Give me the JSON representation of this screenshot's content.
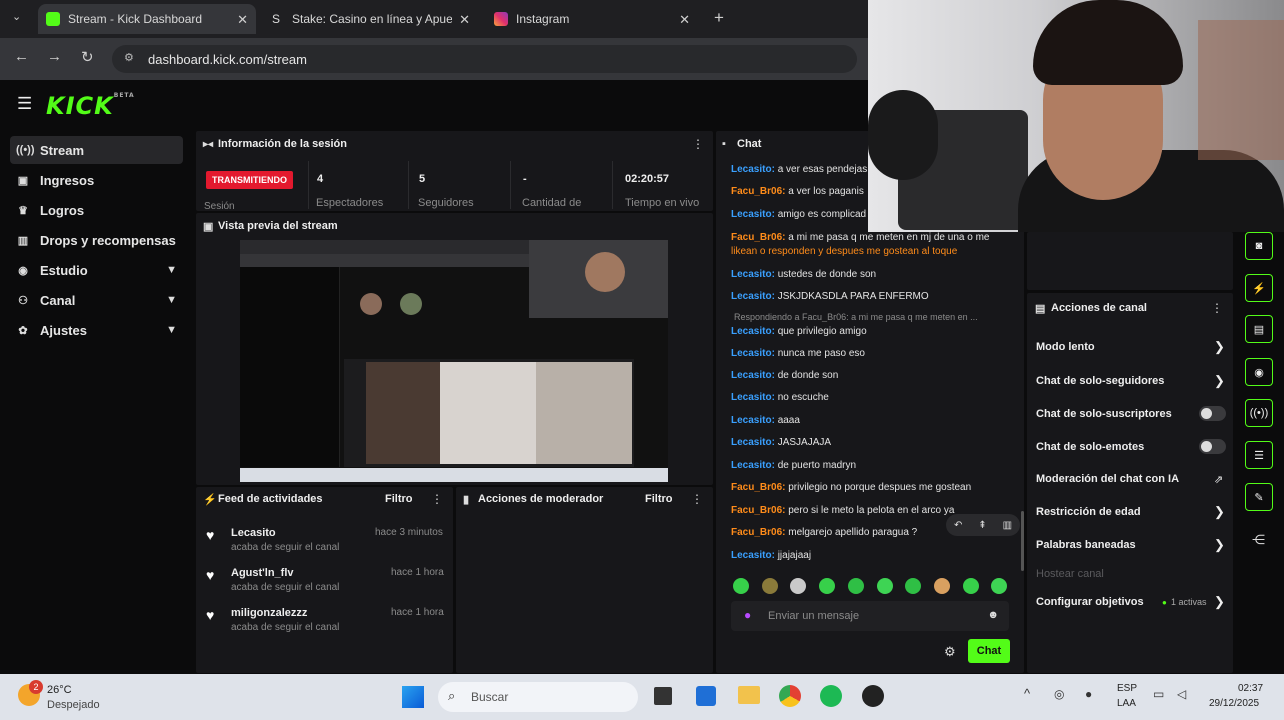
{
  "browser": {
    "tabs": [
      {
        "title": "Stream - Kick Dashboard",
        "icon": "kick-icon"
      },
      {
        "title": "Stake: Casino en línea y Apuest",
        "icon": "stake-icon"
      },
      {
        "title": "Instagram",
        "icon": "instagram-icon"
      }
    ],
    "url": "dashboard.kick.com/stream"
  },
  "kick": {
    "logo": "KICK",
    "beta": "BETA",
    "sidebar": [
      {
        "label": "Stream",
        "icon": "stream-icon"
      },
      {
        "label": "Ingresos",
        "icon": "income-icon"
      },
      {
        "label": "Logros",
        "icon": "trophy-icon"
      },
      {
        "label": "Drops y recompensas",
        "icon": "drops-icon"
      },
      {
        "label": "Estudio",
        "icon": "studio-icon"
      },
      {
        "label": "Canal",
        "icon": "channel-icon"
      },
      {
        "label": "Ajustes",
        "icon": "gear-icon"
      }
    ],
    "session": {
      "title": "Información de la sesión",
      "status": "TRANSMITIENDO",
      "status_sub": "Sesión",
      "stats": [
        {
          "value": "4",
          "label": "Espectadores"
        },
        {
          "value": "5",
          "label": "Seguidores"
        },
        {
          "value": "-",
          "label": "Cantidad de"
        },
        {
          "value": "02:20:57",
          "label": "Tiempo en vivo"
        }
      ]
    },
    "preview": {
      "title": "Vista previa del stream"
    },
    "feed": {
      "title": "Feed de actividades",
      "filter": "Filtro",
      "items": [
        {
          "name": "Lecasito",
          "sub": "acaba de seguir el canal",
          "time": "hace 3 minutos"
        },
        {
          "name": "Agust'ln_flv",
          "sub": "acaba de seguir el canal",
          "time": "hace 1 hora"
        },
        {
          "name": "miligonzalezzz",
          "sub": "acaba de seguir el canal",
          "time": "hace 1 hora"
        }
      ]
    },
    "modactions": {
      "title": "Acciones de moderador",
      "filter": "Filtro"
    },
    "chat": {
      "title": "Chat",
      "messages": [
        {
          "user": "Lecasito",
          "text": "a ver esas pendejas",
          "color": "#3aa0ff"
        },
        {
          "user": "Facu_Br06",
          "text": "a ver los paganis",
          "color": "#ff8c1a"
        },
        {
          "user": "Lecasito",
          "text": "amigo es complicad",
          "color": "#3aa0ff"
        },
        {
          "user": "Facu_Br06",
          "text": "a mi me pasa q me meten en mj de una o me",
          "color": "#ff8c1a"
        },
        {
          "user": "",
          "text": "likean o responden y despues me gostean al toque",
          "color": "#ff8c1a"
        },
        {
          "user": "Lecasito",
          "text": "ustedes de donde son",
          "color": "#3aa0ff"
        },
        {
          "user": "Lecasito",
          "text": "JSKJDKASDLA PARA ENFERMO",
          "color": "#3aa0ff"
        },
        {
          "user": "",
          "text": "Respondiendo a Facu_Br06: a mi me pasa q me meten en ...",
          "color": "#8b8b8b"
        },
        {
          "user": "Lecasito",
          "text": "que privilegio amigo",
          "color": "#3aa0ff"
        },
        {
          "user": "Lecasito",
          "text": "nunca me paso eso",
          "color": "#3aa0ff"
        },
        {
          "user": "Lecasito",
          "text": "de donde son",
          "color": "#3aa0ff"
        },
        {
          "user": "Lecasito",
          "text": "no escuche",
          "color": "#3aa0ff"
        },
        {
          "user": "Lecasito",
          "text": "aaaa",
          "color": "#3aa0ff"
        },
        {
          "user": "Lecasito",
          "text": "JASJAJAJA",
          "color": "#3aa0ff"
        },
        {
          "user": "Lecasito",
          "text": "de puerto madryn",
          "color": "#3aa0ff"
        },
        {
          "user": "Facu_Br06",
          "text": "privilegio no porque despues me gostean",
          "color": "#ff8c1a"
        },
        {
          "user": "Facu_Br06",
          "text": "pero si le meto la pelota en el arco ya",
          "color": "#ff8c1a"
        },
        {
          "user": "Facu_Br06",
          "text": "melgarejo apellido paragua ?",
          "color": "#ff8c1a"
        },
        {
          "user": "Lecasito",
          "text": "jjajajaaj",
          "color": "#3aa0ff"
        }
      ],
      "input_placeholder": "Enviar un mensaje",
      "send": "Chat"
    },
    "channel_actions": {
      "title": "Acciones de canal",
      "items": [
        {
          "label": "Modo lento",
          "control": "chevron"
        },
        {
          "label": "Chat de solo-seguidores",
          "control": "chevron"
        },
        {
          "label": "Chat de solo-suscriptores",
          "control": "toggle"
        },
        {
          "label": "Chat de solo-emotes",
          "control": "toggle"
        },
        {
          "label": "Moderación del chat con IA",
          "control": "external"
        },
        {
          "label": "Restricción de edad",
          "control": "chevron"
        },
        {
          "label": "Palabras baneadas",
          "control": "chevron"
        },
        {
          "label": "Hostear canal",
          "control": "none"
        },
        {
          "label": "Configurar objetivos",
          "control": "chevron",
          "badge": "1 activas"
        }
      ]
    }
  },
  "taskbar": {
    "weather_temp": "26°C",
    "weather_desc": "Despejado",
    "weather_badge": "2",
    "search": "Buscar",
    "lang": "ESP",
    "lang2": "LAA",
    "time": "02:37",
    "date": "29/12/2025"
  },
  "colors": {
    "kick_green": "#53fc18",
    "live_red": "#e3192e"
  }
}
